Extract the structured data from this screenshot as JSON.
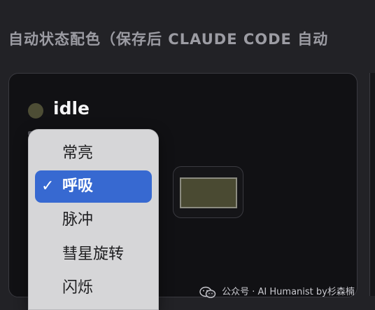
{
  "section": {
    "title": "自动状态配色（保存后 CLAUDE CODE 自动"
  },
  "status": {
    "name": "idle",
    "dot_color": "#4d4d35",
    "swatch_color": "#4a4a32"
  },
  "effect_menu": {
    "selected_index": 1,
    "items": [
      {
        "label": "常亮"
      },
      {
        "label": "呼吸",
        "checkmark": "✓"
      },
      {
        "label": "脉冲"
      },
      {
        "label": "彗星旋转"
      },
      {
        "label": "闪烁"
      }
    ]
  },
  "watermark": {
    "text": "公众号 · AI Humanist by杉森楠",
    "icon": "wechat-icon"
  },
  "colors": {
    "accent": "#3769d1",
    "background": "#222226",
    "card": "#111114"
  }
}
